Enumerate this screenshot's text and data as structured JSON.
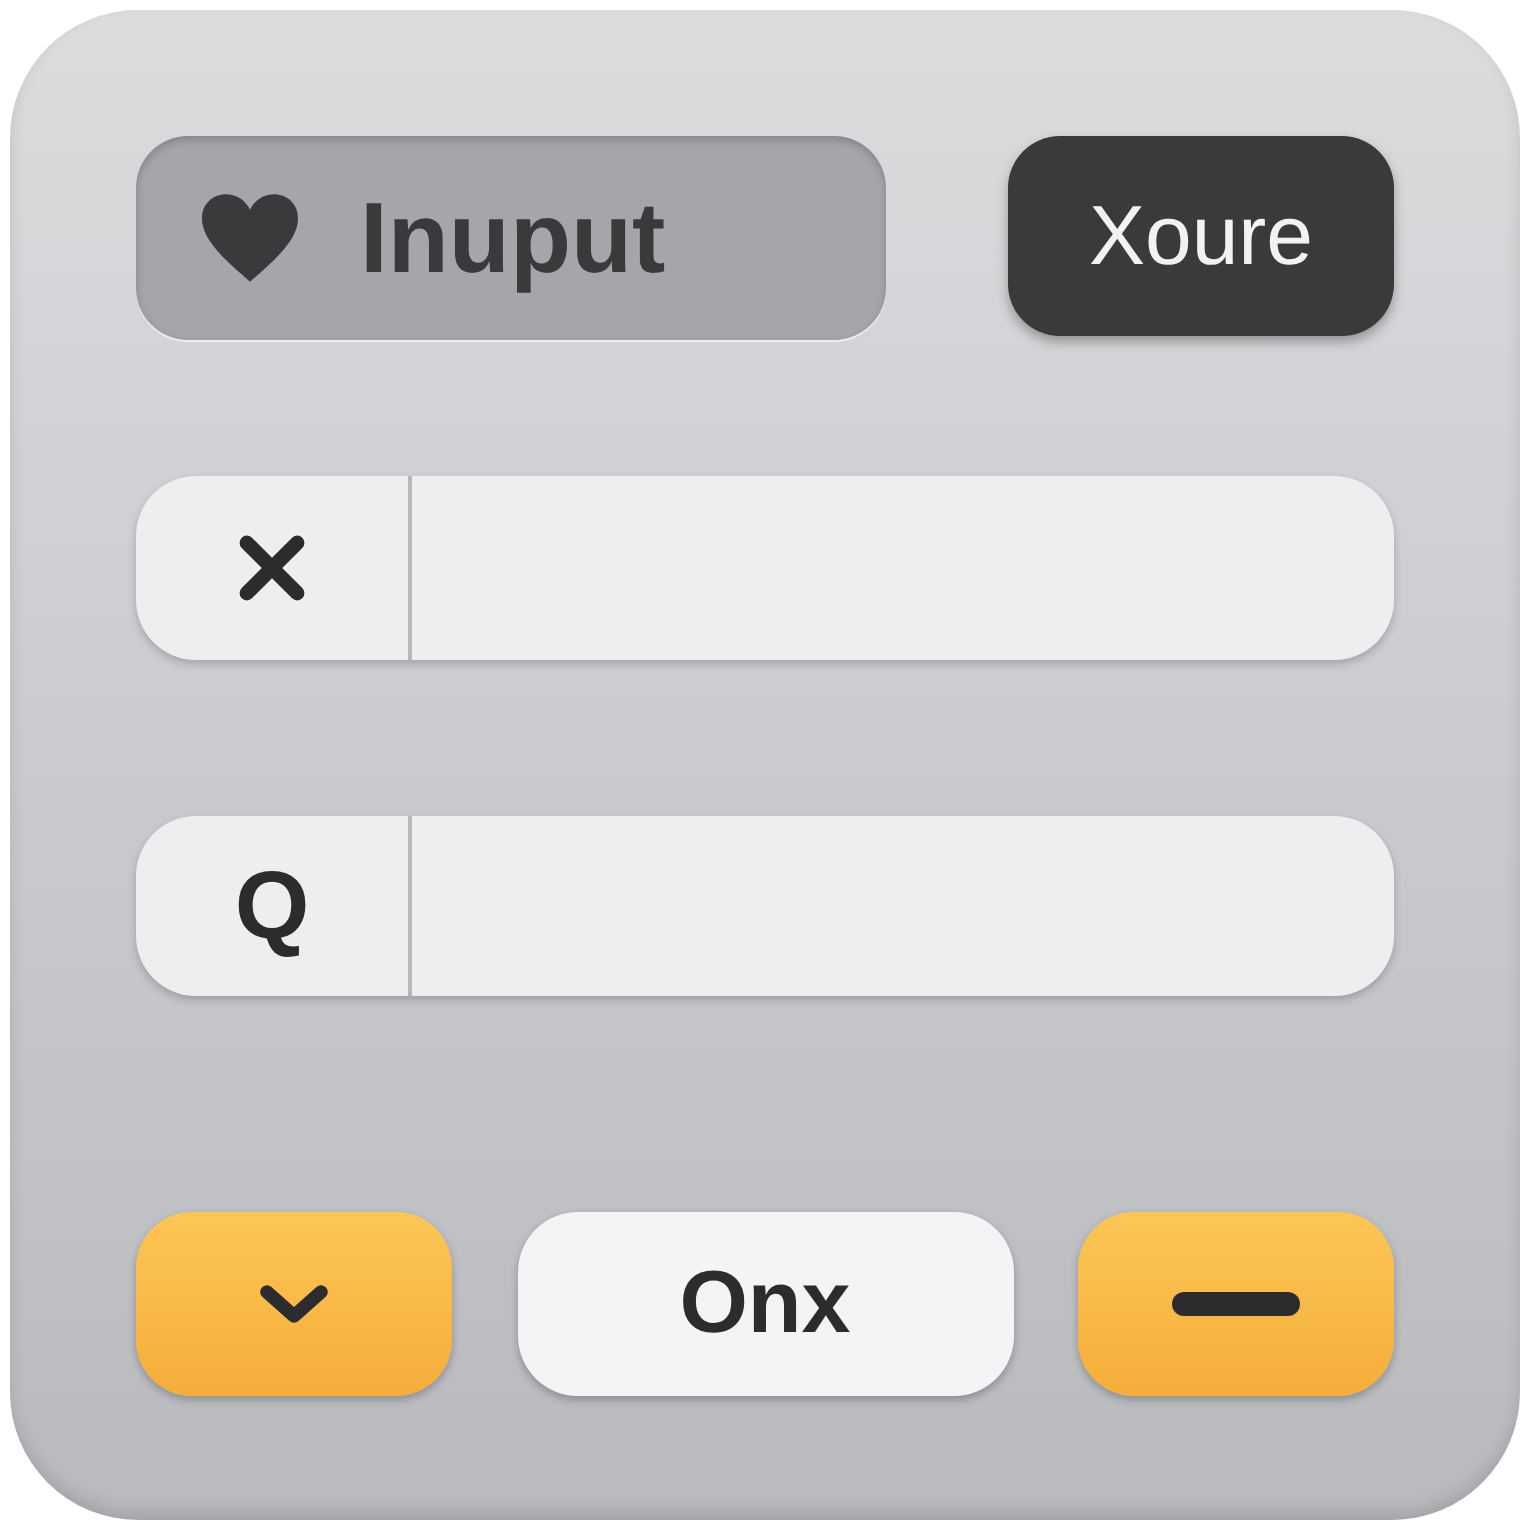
{
  "top_row": {
    "input_pill": {
      "label": "Inuput"
    },
    "dark_button": {
      "label": "Xoure"
    }
  },
  "fields": [
    {
      "kind": "clear"
    },
    {
      "kind": "letter",
      "icon_char": "Q"
    }
  ],
  "bottom_buttons": [
    {
      "kind": "chevron"
    },
    {
      "kind": "text",
      "label": "Onx"
    },
    {
      "kind": "minus"
    }
  ]
}
